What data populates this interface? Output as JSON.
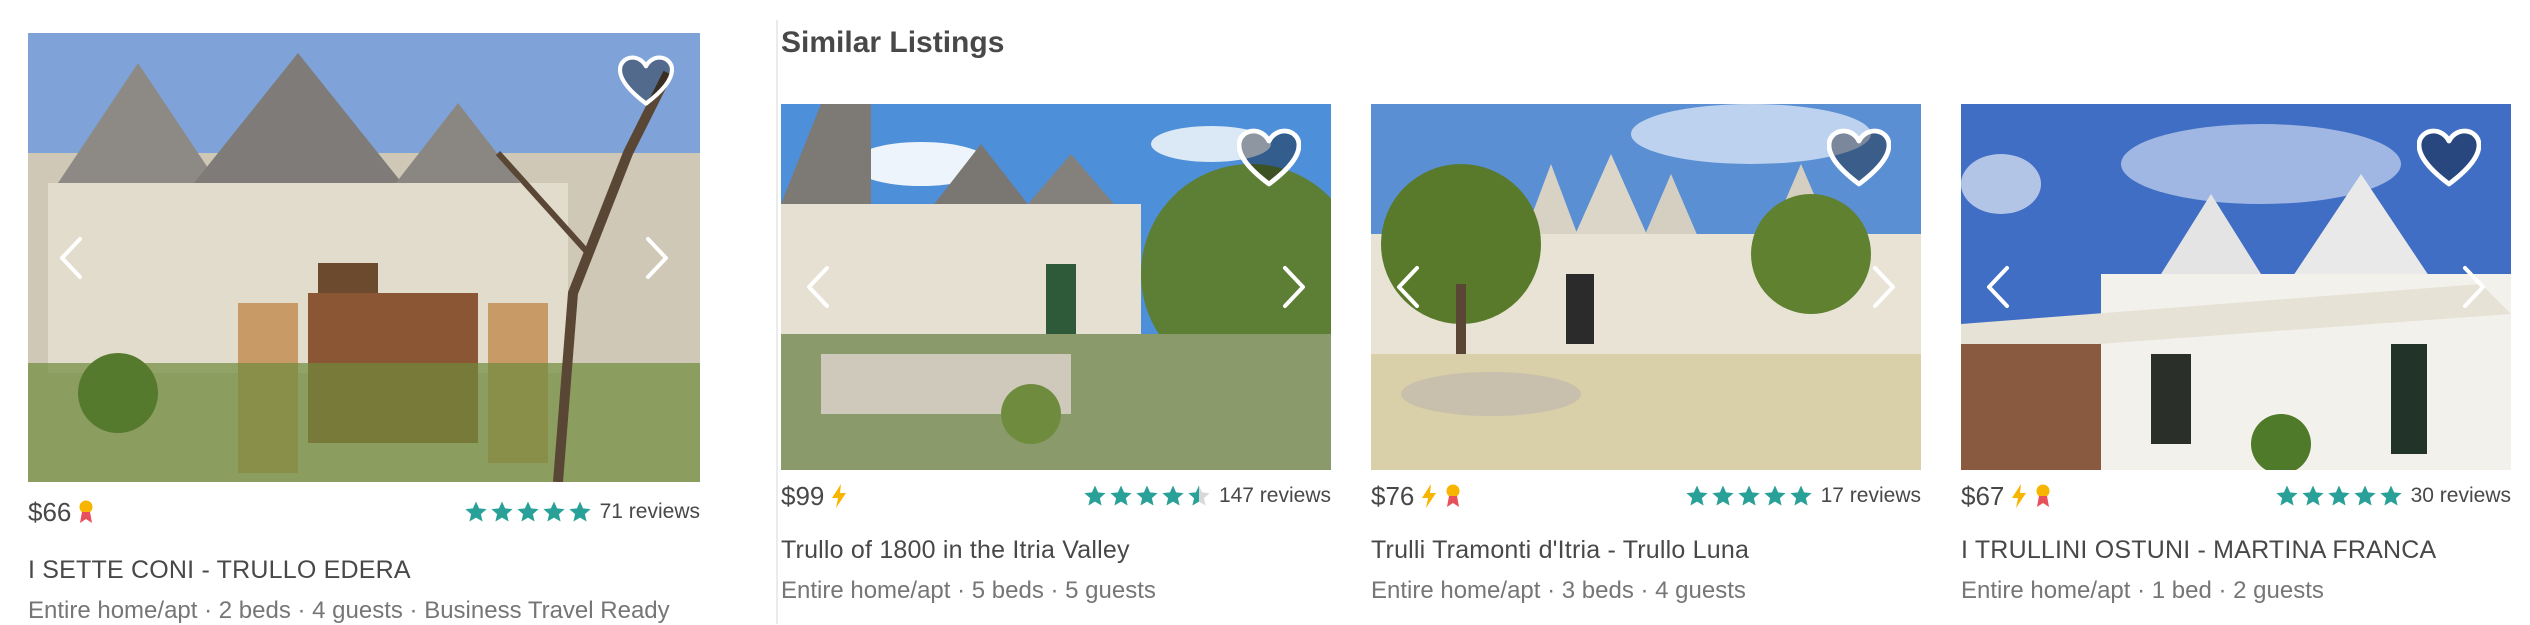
{
  "colors": {
    "star": "#2aa198",
    "text": "#484848",
    "muted": "#767676",
    "bolt": "#f7b500",
    "award": "#e8505b"
  },
  "main_listing": {
    "price": "$66",
    "badges": [
      "award-icon"
    ],
    "stars": 5,
    "reviews": "71 reviews",
    "name": "I SETTE CONI - TRULLO EDERA",
    "details": "Entire home/apt · 2 beds · 4 guests · Business Travel Ready"
  },
  "similar": {
    "title": "Similar Listings",
    "items": [
      {
        "price": "$99",
        "badges": [
          "bolt-icon"
        ],
        "stars": 4.5,
        "reviews": "147 reviews",
        "name": "Trullo of 1800 in the Itria Valley",
        "details": "Entire home/apt · 5 beds · 5 guests"
      },
      {
        "price": "$76",
        "badges": [
          "bolt-icon",
          "award-icon"
        ],
        "stars": 5,
        "reviews": "17 reviews",
        "name": "Trulli Tramonti d'Itria - Trullo Luna",
        "details": "Entire home/apt · 3 beds · 4 guests"
      },
      {
        "price": "$67",
        "badges": [
          "bolt-icon",
          "award-icon"
        ],
        "stars": 5,
        "reviews": "30 reviews",
        "name": "I TRULLINI OSTUNI - MARTINA FRANCA",
        "details": "Entire home/apt · 1 bed · 2 guests"
      }
    ]
  }
}
